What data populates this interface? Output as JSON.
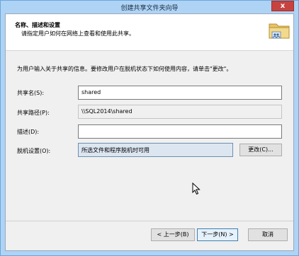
{
  "window": {
    "title": "创建共享文件夹向导",
    "close_label": "x"
  },
  "header": {
    "title": "名称、描述和设置",
    "subtitle": "请指定用户如何在网络上查看和使用此共享。"
  },
  "description": "为用户输入关于共享的信息。要修改用户在脱机状态下如何使用内容，请单击\"更改\"。",
  "form": {
    "share_name": {
      "label": "共享名(S):",
      "value": "shared"
    },
    "share_path": {
      "label": "共享路径(P):",
      "value": "\\\\SQL2014\\shared"
    },
    "description": {
      "label": "描述(D):",
      "value": ""
    },
    "offline": {
      "label": "脱机设置(O):",
      "value": "所选文件和程序脱机时可用",
      "change_label": "更改(C)..."
    }
  },
  "buttons": {
    "prev": "< 上一步(B)",
    "next": "下一步(N) >",
    "cancel": "取消"
  },
  "icons": {
    "header": "shared-folder-icon",
    "close": "close-icon",
    "cursor": "mouse-cursor-icon"
  },
  "colors": {
    "titlebar": "#aed3f4",
    "close": "#c7433f",
    "selected_field": "#dce6f1"
  }
}
